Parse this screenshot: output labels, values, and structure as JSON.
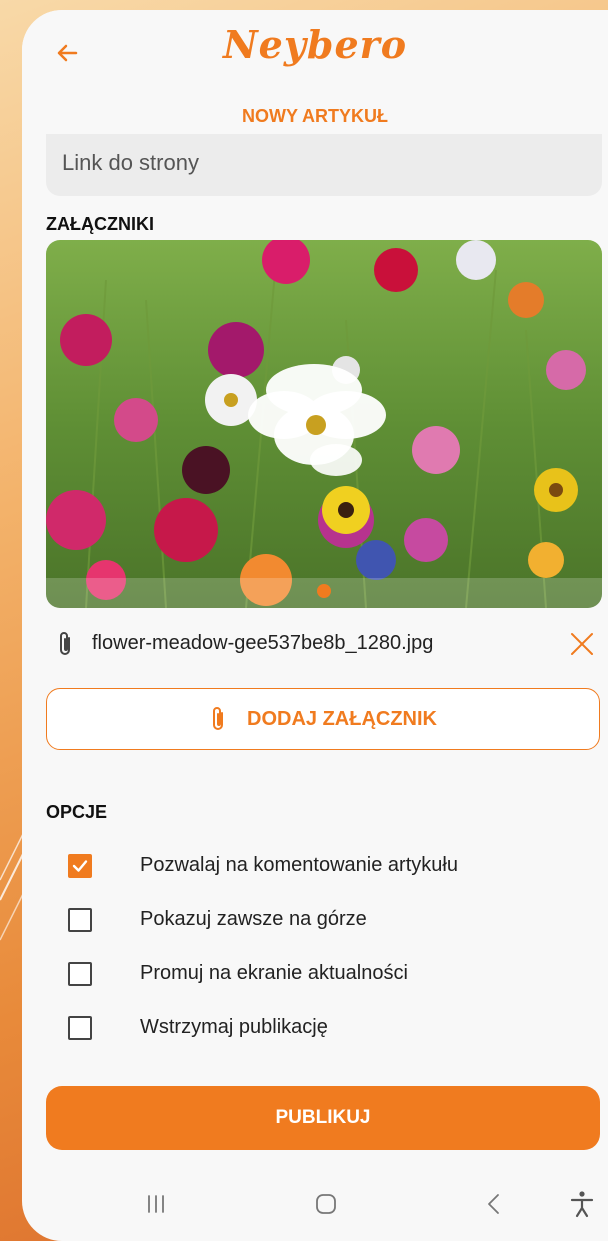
{
  "header": {
    "logo_text": "Neybero",
    "page_title": "NOWY ARTYKUŁ"
  },
  "link_field": {
    "placeholder": "Link do strony",
    "value": ""
  },
  "attachments": {
    "section_title": "ZAŁĄCZNIKI",
    "image_alt": "flower meadow photo",
    "carousel_active_index": 0,
    "carousel_total": 1,
    "file_name": "flower-meadow-gee537be8b_1280.jpg",
    "add_button_label": "DODAJ ZAŁĄCZNIK"
  },
  "options": {
    "section_title": "OPCJE",
    "items": [
      {
        "label": "Pozwalaj na komentowanie artykułu",
        "checked": true
      },
      {
        "label": "Pokazuj zawsze na górze",
        "checked": false
      },
      {
        "label": "Promuj na ekranie aktualności",
        "checked": false
      },
      {
        "label": "Wstrzymaj publikację",
        "checked": false
      }
    ]
  },
  "publish_button_label": "PUBLIKUJ",
  "navbar": [
    "recent-apps-icon",
    "home-icon",
    "back-nav-icon",
    "accessibility-icon"
  ],
  "colors": {
    "accent": "#f07b1f",
    "field_bg": "#ececec",
    "screen_bg": "#f8f8f8"
  }
}
